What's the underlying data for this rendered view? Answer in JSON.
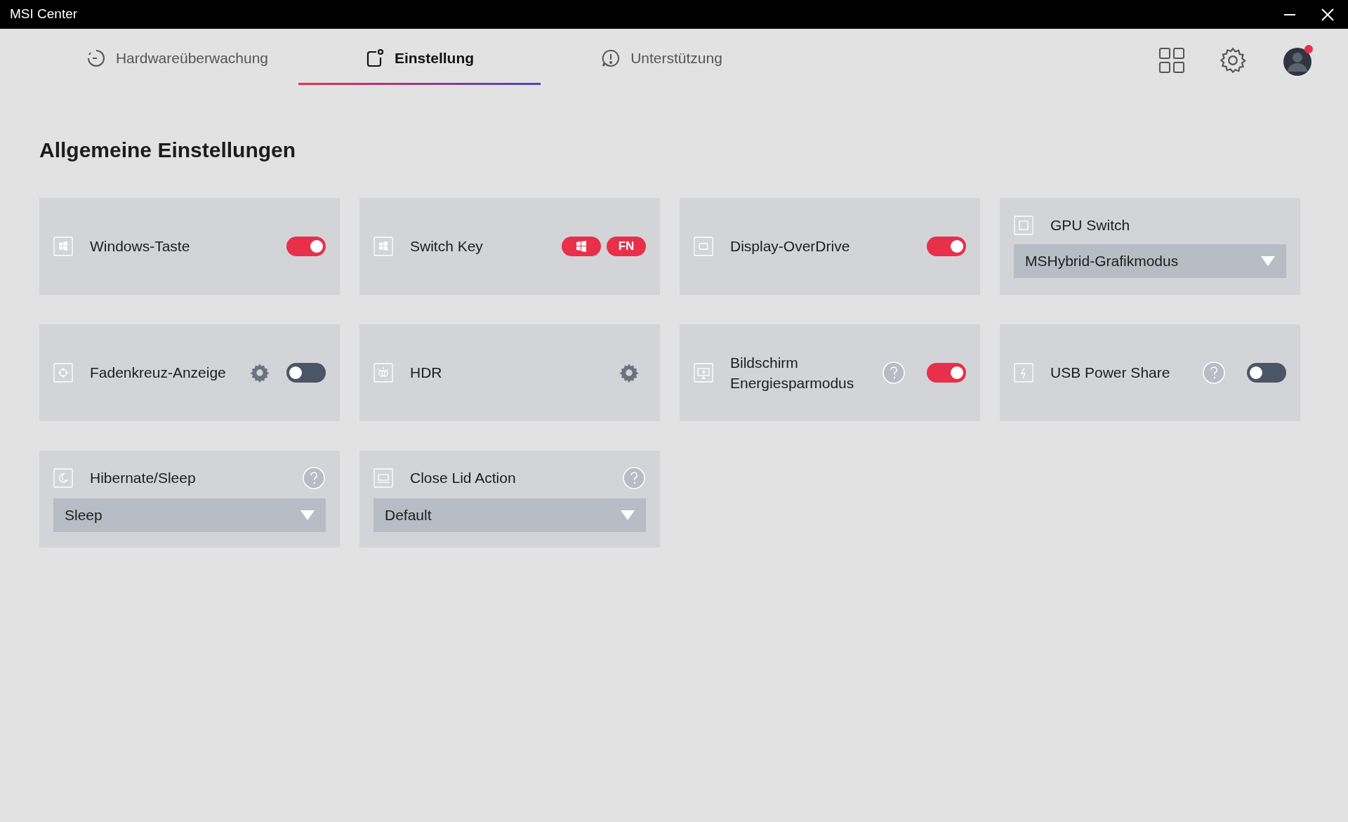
{
  "window": {
    "title": "MSI Center"
  },
  "tabs": [
    {
      "label": "Hardwareüberwachung",
      "selected": false
    },
    {
      "label": "Einstellung",
      "selected": true
    },
    {
      "label": "Unterstützung",
      "selected": false
    }
  ],
  "heading": "Allgemeine Einstellungen",
  "settings": [
    {
      "kind": "toggle",
      "label": "Windows-Taste",
      "on": true,
      "gear": false,
      "help": false
    },
    {
      "kind": "keys",
      "label": "Switch Key",
      "keys": [
        "FN"
      ]
    },
    {
      "kind": "toggle",
      "label": "Display-OverDrive",
      "on": true,
      "gear": false,
      "help": false
    },
    {
      "kind": "select",
      "label": "GPU Switch",
      "value": "MSHybrid-Grafikmodus",
      "help": false
    },
    {
      "kind": "toggle",
      "label": "Fadenkreuz-Anzeige",
      "on": false,
      "gear": true,
      "help": false
    },
    {
      "kind": "gear",
      "label": "HDR"
    },
    {
      "kind": "toggle",
      "label": "Bildschirm Energiesparmodus",
      "on": true,
      "gear": false,
      "help": true
    },
    {
      "kind": "toggle",
      "label": "USB Power Share",
      "on": false,
      "gear": false,
      "help": true
    },
    {
      "kind": "select",
      "label": "Hibernate/Sleep",
      "value": "Sleep",
      "help": true
    },
    {
      "kind": "select",
      "label": "Close Lid Action",
      "value": "Default",
      "help": true
    }
  ]
}
